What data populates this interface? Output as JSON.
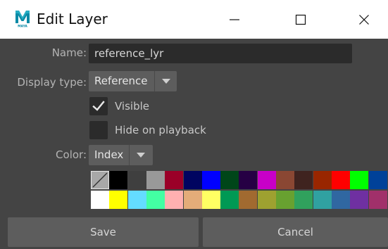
{
  "window": {
    "title": "Edit Layer",
    "app_icon": "maya-logo-icon",
    "app_icon_caption": "MAYA",
    "controls": [
      "minimize-icon",
      "maximize-icon",
      "close-icon"
    ]
  },
  "form": {
    "name_label": "Name:",
    "name_value": "reference_lyr",
    "display_type_label": "Display type:",
    "display_type_value": "Reference",
    "visible_label": "Visible",
    "visible_checked": true,
    "hide_on_playback_label": "Hide on playback",
    "hide_on_playback_checked": false,
    "color_label": "Color:",
    "color_mode_value": "Index"
  },
  "palette": {
    "row1": [
      "none",
      "#000000",
      "#3f3f3f",
      "#999999",
      "#9b0028",
      "#000460",
      "#0000ff",
      "#004619",
      "#260044",
      "#c800c8",
      "#8a4733",
      "#3f231f",
      "#992600",
      "#ff0000",
      "#00ff00",
      "#004199"
    ],
    "row2": [
      "#ffffff",
      "#ffff00",
      "#64dcff",
      "#43ffa3",
      "#ffb0b0",
      "#e4ac79",
      "#ffff63",
      "#009954",
      "#a16a30",
      "#9ea130",
      "#68a130",
      "#30a15d",
      "#30a1a1",
      "#3067a1",
      "#6f30a1",
      "#a1306a"
    ],
    "selected_index": 0
  },
  "buttons": {
    "save": "Save",
    "cancel": "Cancel"
  },
  "colors": {
    "background": "#444444",
    "field": "#2b2b2b",
    "button": "#5d5d5d",
    "label_text": "#b4b4b4",
    "brand": "#0696d7"
  }
}
